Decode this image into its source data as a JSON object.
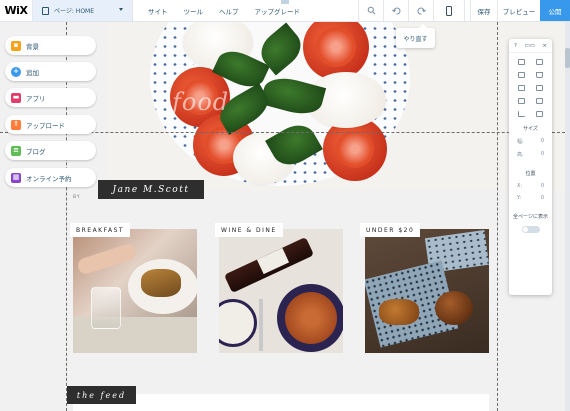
{
  "topbar": {
    "logo": "WiX",
    "page_select": "ページ: HOME",
    "menu": [
      "サイト",
      "ツール",
      "ヘルプ",
      "アップグレード"
    ],
    "zoom_icon": "zoom-icon",
    "undo_icon": "undo-icon",
    "redo_icon": "redo-icon",
    "device_icon": "mobile-icon",
    "save": "保存",
    "preview": "プレビュー",
    "publish": "公開"
  },
  "undo_tooltip": "やり直す",
  "left_panel": {
    "items": [
      {
        "label": "背景",
        "icon": "background-icon",
        "color": "#f7a21b"
      },
      {
        "label": "追加",
        "icon": "add-icon",
        "color": "#3899ec"
      },
      {
        "label": "アプリ",
        "icon": "app-icon",
        "color": "#e23e6d"
      },
      {
        "label": "アップロード",
        "icon": "upload-icon",
        "color": "#ff7d38"
      },
      {
        "label": "ブログ",
        "icon": "blog-icon",
        "color": "#60bc57"
      },
      {
        "label": "オンライン予約",
        "icon": "booking-icon",
        "color": "#8a46c7"
      }
    ]
  },
  "site": {
    "hero_script": "food",
    "author": "Jane M.Scott",
    "by": "BY",
    "cards": [
      {
        "label": "BREAKFAST"
      },
      {
        "label": "WINE & DINE"
      },
      {
        "label": "UNDER $20"
      }
    ],
    "feed_title": "the feed"
  },
  "right_panel": {
    "head_help": "?",
    "head_more": "▭▭",
    "head_close": "×",
    "size_label": "サイズ",
    "width_label": "幅:",
    "height_label": "高:",
    "width_value": "0",
    "height_value": "0",
    "position_label": "位置",
    "x_label": "X:",
    "y_label": "Y:",
    "x_value": "0",
    "y_value": "0",
    "show_all_pages": "全ページに表示"
  }
}
